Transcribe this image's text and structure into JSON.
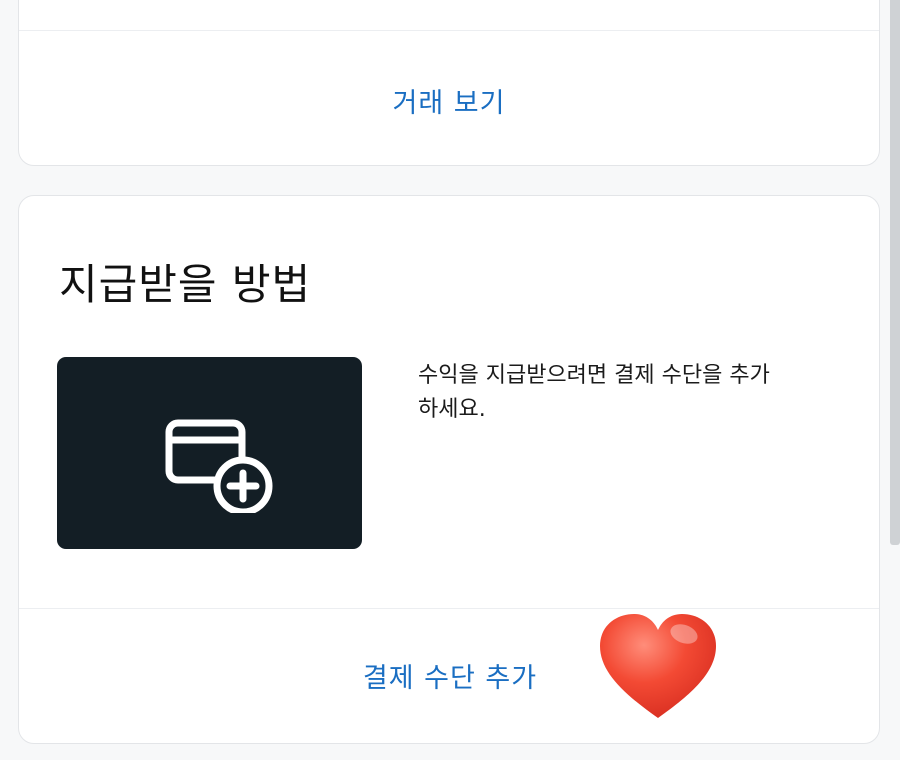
{
  "top_card": {
    "view_transactions_label": "거래 보기"
  },
  "payment_card": {
    "title": "지급받을 방법",
    "description": "수익을 지급받으려면 결제 수단을 추가하세요.",
    "add_payment_label": "결제 수단 추가",
    "tile_icon": "card-add-icon"
  },
  "overlay": {
    "sticker": "heart-icon"
  },
  "colors": {
    "link": "#1a6ec2",
    "tile": "#131e25",
    "heart": "#ef3b2d"
  }
}
